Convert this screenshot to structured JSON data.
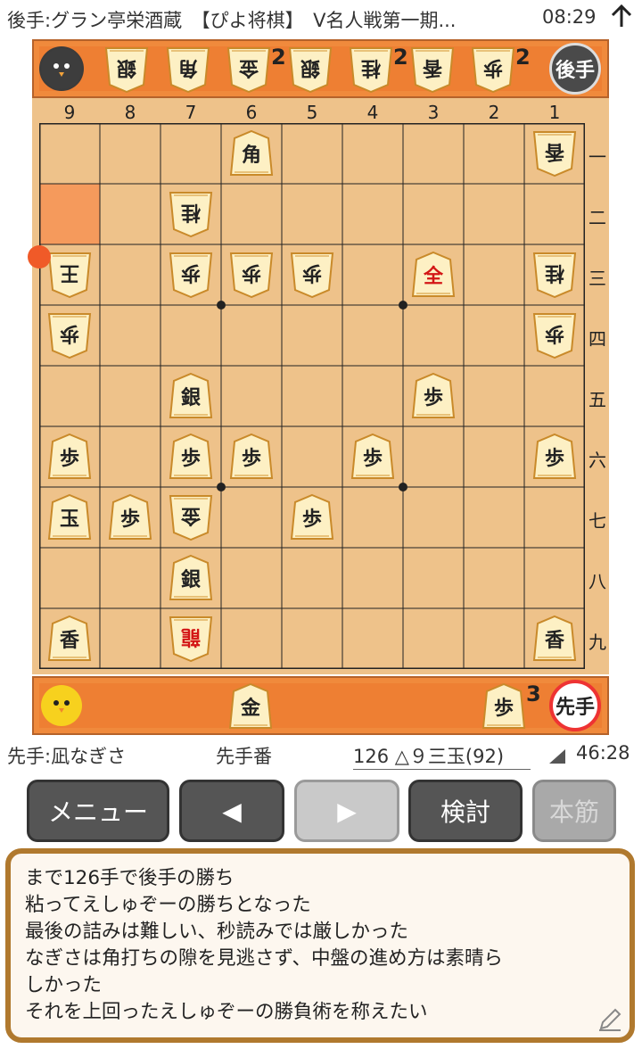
{
  "status_bar": {
    "title": "後手:グラン亭栄酒蔵　【ぴよ将棋】　V名人戦第一期...",
    "time": "08:29",
    "upload_icon": "arrow-up-icon"
  },
  "gote_hand": {
    "pieces": [
      {
        "label": "銀",
        "count": ""
      },
      {
        "label": "角",
        "count": ""
      },
      {
        "label": "金",
        "count": "2"
      },
      {
        "label": "銀",
        "count": ""
      },
      {
        "label": "桂",
        "count": "2"
      },
      {
        "label": "香",
        "count": ""
      },
      {
        "label": "歩",
        "count": "2"
      }
    ],
    "badge": "後手"
  },
  "sente_hand": {
    "pieces": [
      {
        "label": "金",
        "count": ""
      },
      {
        "label": "歩",
        "count": "3"
      }
    ],
    "badge": "先手"
  },
  "board": {
    "col_labels": [
      "9",
      "8",
      "7",
      "6",
      "5",
      "4",
      "3",
      "2",
      "1"
    ],
    "row_labels": [
      "一",
      "二",
      "三",
      "四",
      "五",
      "六",
      "七",
      "八",
      "九"
    ],
    "pieces": [
      {
        "file": 6,
        "rank": 1,
        "label": "角",
        "owner": "sente",
        "promoted": false
      },
      {
        "file": 1,
        "rank": 1,
        "label": "香",
        "owner": "gote",
        "promoted": false
      },
      {
        "file": 7,
        "rank": 2,
        "label": "桂",
        "owner": "gote",
        "promoted": false
      },
      {
        "file": 9,
        "rank": 3,
        "label": "王",
        "owner": "gote",
        "promoted": false
      },
      {
        "file": 7,
        "rank": 3,
        "label": "歩",
        "owner": "gote",
        "promoted": false
      },
      {
        "file": 6,
        "rank": 3,
        "label": "歩",
        "owner": "gote",
        "promoted": false
      },
      {
        "file": 5,
        "rank": 3,
        "label": "歩",
        "owner": "gote",
        "promoted": false
      },
      {
        "file": 3,
        "rank": 3,
        "label": "全",
        "owner": "sente",
        "promoted": true
      },
      {
        "file": 1,
        "rank": 3,
        "label": "桂",
        "owner": "gote",
        "promoted": false
      },
      {
        "file": 9,
        "rank": 4,
        "label": "歩",
        "owner": "gote",
        "promoted": false
      },
      {
        "file": 1,
        "rank": 4,
        "label": "歩",
        "owner": "gote",
        "promoted": false
      },
      {
        "file": 7,
        "rank": 5,
        "label": "銀",
        "owner": "sente",
        "promoted": false
      },
      {
        "file": 3,
        "rank": 5,
        "label": "歩",
        "owner": "sente",
        "promoted": false
      },
      {
        "file": 9,
        "rank": 6,
        "label": "歩",
        "owner": "sente",
        "promoted": false
      },
      {
        "file": 7,
        "rank": 6,
        "label": "歩",
        "owner": "sente",
        "promoted": false
      },
      {
        "file": 6,
        "rank": 6,
        "label": "歩",
        "owner": "sente",
        "promoted": false
      },
      {
        "file": 4,
        "rank": 6,
        "label": "歩",
        "owner": "sente",
        "promoted": false
      },
      {
        "file": 1,
        "rank": 6,
        "label": "歩",
        "owner": "sente",
        "promoted": false
      },
      {
        "file": 9,
        "rank": 7,
        "label": "玉",
        "owner": "sente",
        "promoted": false
      },
      {
        "file": 8,
        "rank": 7,
        "label": "歩",
        "owner": "sente",
        "promoted": false
      },
      {
        "file": 7,
        "rank": 7,
        "label": "金",
        "owner": "gote",
        "promoted": false
      },
      {
        "file": 5,
        "rank": 7,
        "label": "歩",
        "owner": "sente",
        "promoted": false
      },
      {
        "file": 7,
        "rank": 8,
        "label": "銀",
        "owner": "sente",
        "promoted": false
      },
      {
        "file": 9,
        "rank": 9,
        "label": "香",
        "owner": "sente",
        "promoted": false
      },
      {
        "file": 7,
        "rank": 9,
        "label": "龍",
        "owner": "gote",
        "promoted": true
      },
      {
        "file": 1,
        "rank": 9,
        "label": "香",
        "owner": "sente",
        "promoted": false
      }
    ],
    "last_move_from": {
      "file": 9,
      "rank": 2
    },
    "last_move_to": {
      "file": 9,
      "rank": 3
    }
  },
  "info_bar": {
    "sente_player": "先手:凪なぎさ",
    "turn": "先手番",
    "move": "126 △９三玉(92)",
    "clock": "46:28"
  },
  "buttons": {
    "menu": "メニュー",
    "prev": "◀",
    "next": "▶",
    "analyze": "検討",
    "mainline": "本筋"
  },
  "comment": {
    "lines": [
      "まで126手で後手の勝ち",
      "粘ってえしゅぞーの勝ちとなった",
      "最後の詰みは難しい、秒読みでは厳しかった",
      "なぎさは角打ちの隙を見逃さず、中盤の進め方は素晴ら",
      "しかった",
      "それを上回ったえしゅぞーの勝負術を称えたい"
    ],
    "edit_icon": "pencil-icon"
  },
  "colors": {
    "board": "#eec28a",
    "hand_bar": "#ee7f33",
    "highlight": "#f59a5c",
    "last_move_dot": "#f05a28",
    "promoted_text": "#d31616",
    "button_dark": "#555555"
  }
}
